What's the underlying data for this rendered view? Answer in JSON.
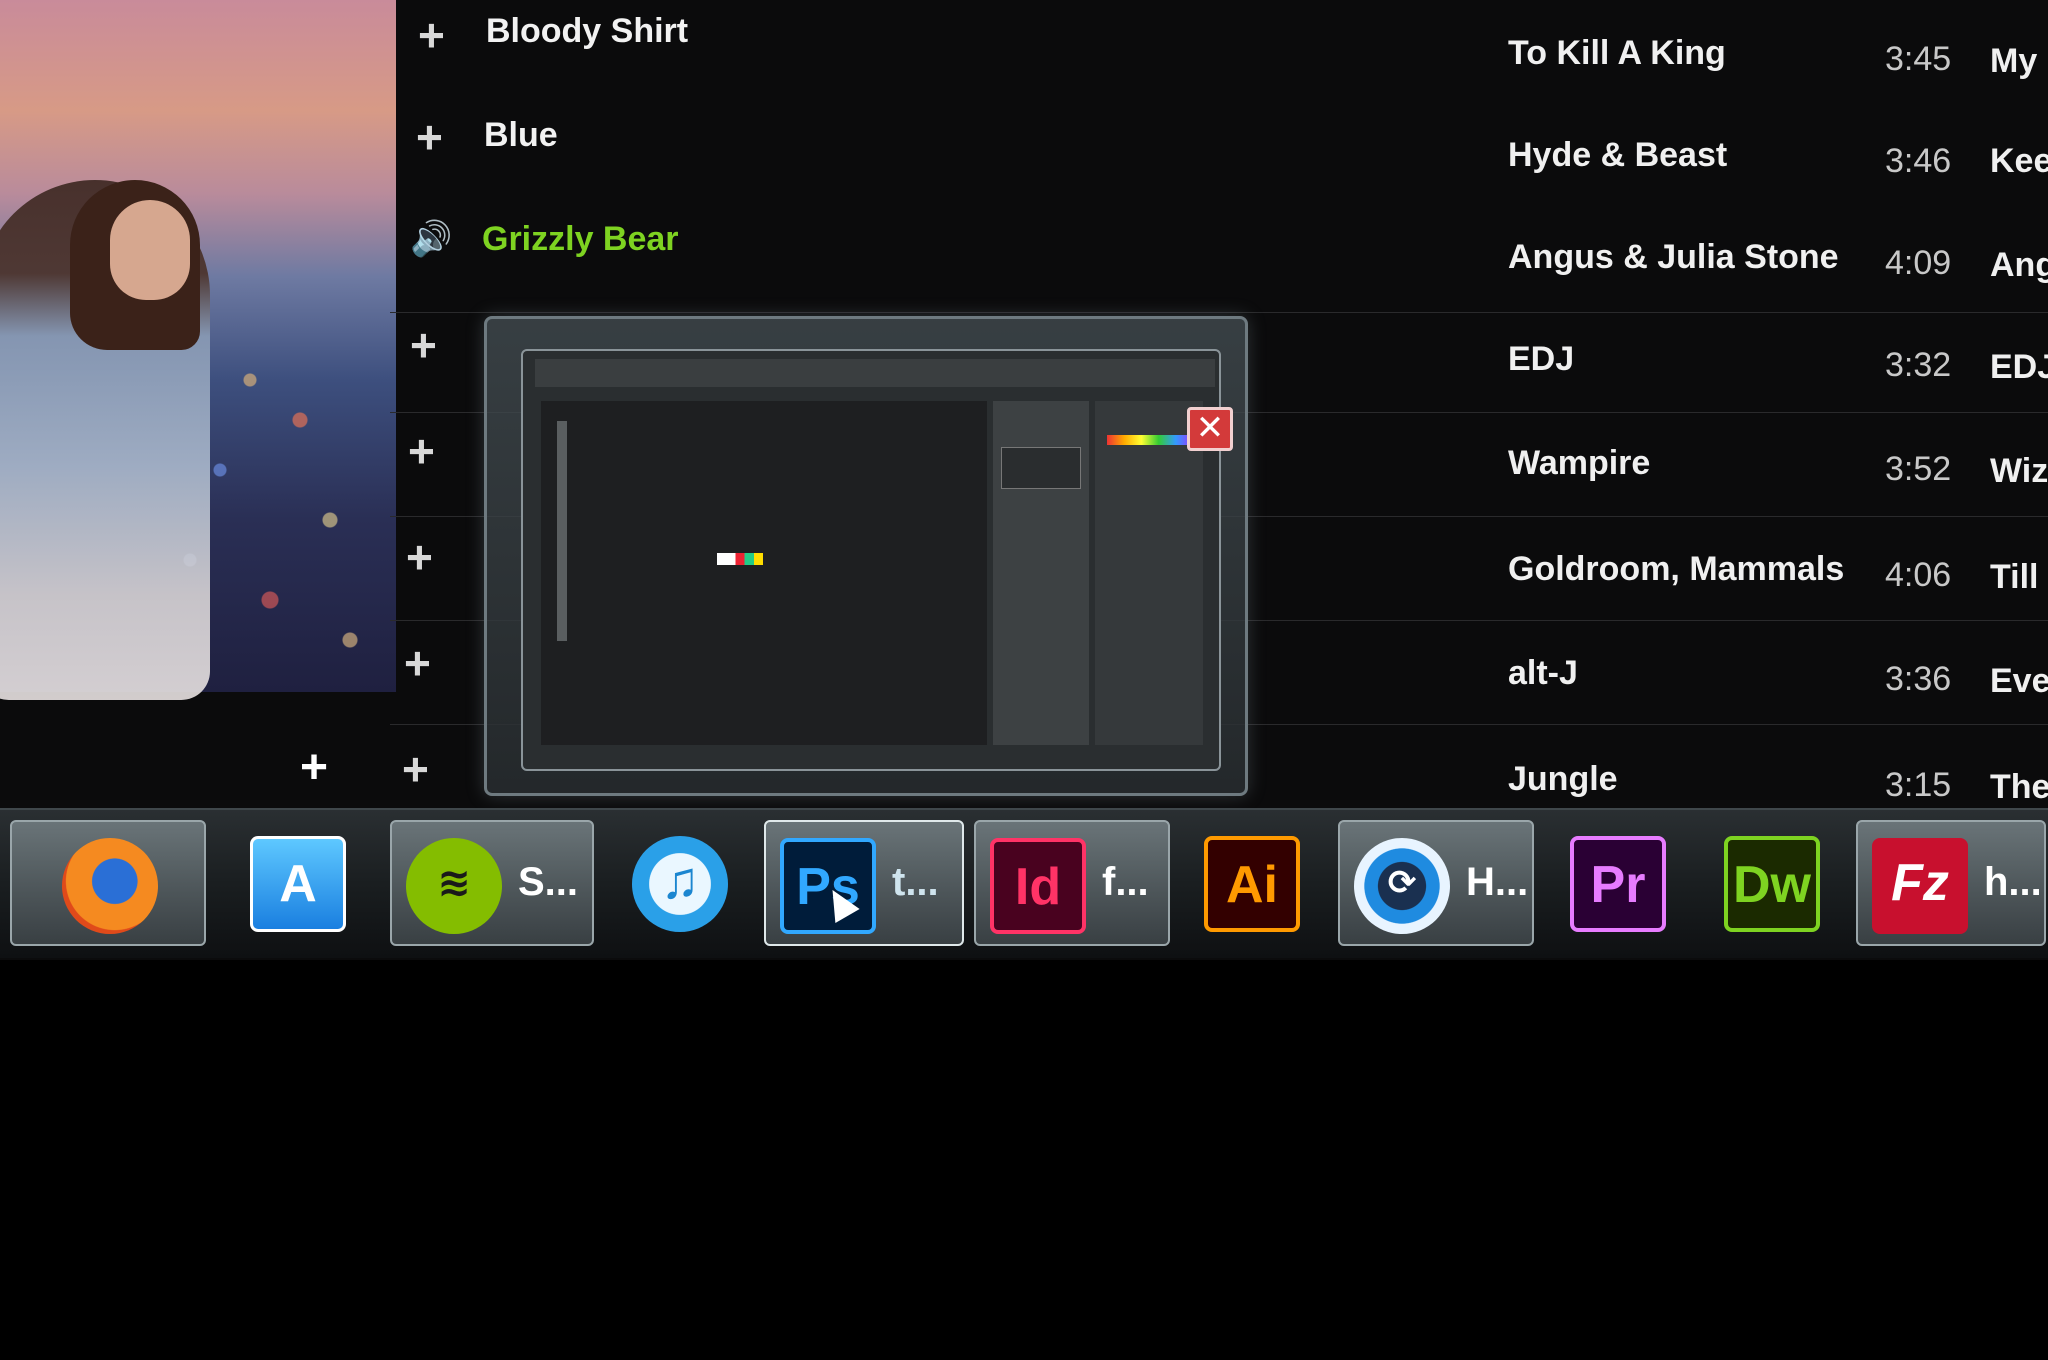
{
  "player": {
    "left_add_label": "+",
    "left_tracks": [
      {
        "title": "Bloody Shirt",
        "state": "add",
        "glyph": "+"
      },
      {
        "title": "Blue",
        "state": "add",
        "glyph": "+"
      },
      {
        "title": "Grizzly Bear",
        "state": "playing",
        "glyph": "🔊"
      },
      {
        "title": "",
        "state": "add",
        "glyph": "+"
      },
      {
        "title": "",
        "state": "add",
        "glyph": "+"
      },
      {
        "title": "",
        "state": "add",
        "glyph": "+"
      },
      {
        "title": "",
        "state": "add",
        "glyph": "+"
      },
      {
        "title": "",
        "state": "add",
        "glyph": "+"
      }
    ],
    "right_rows": [
      {
        "artist": "To Kill A King",
        "duration": "3:45",
        "album": "My"
      },
      {
        "artist": "Hyde & Beast",
        "duration": "3:46",
        "album": "Kee"
      },
      {
        "artist": "Angus & Julia Stone",
        "duration": "4:09",
        "album": "Ang",
        "playing": true
      },
      {
        "artist": "EDJ",
        "duration": "3:32",
        "album": "EDJ"
      },
      {
        "artist": "Wampire",
        "duration": "3:52",
        "album": "Wiz"
      },
      {
        "artist": "Goldroom, Mammals",
        "duration": "4:06",
        "album": "Till"
      },
      {
        "artist": "alt-J",
        "duration": "3:36",
        "album": "Eve"
      },
      {
        "artist": "Jungle",
        "duration": "3:15",
        "album": "The"
      }
    ],
    "accent_color": "#7ed321"
  },
  "preview": {
    "close_label": "✕"
  },
  "taskbar": {
    "items": [
      {
        "icon": "firefox-icon",
        "glyph": "",
        "label": "",
        "active": true
      },
      {
        "icon": "app-store-icon",
        "glyph": "A",
        "label": "",
        "active": false
      },
      {
        "icon": "spotify-icon",
        "glyph": "≋",
        "label": "S...",
        "active": true
      },
      {
        "icon": "itunes-icon",
        "glyph": "♫",
        "label": "",
        "active": false
      },
      {
        "icon": "photoshop-icon",
        "glyph": "Ps",
        "label": "t...",
        "active": true
      },
      {
        "icon": "indesign-icon",
        "glyph": "Id",
        "label": "f...",
        "active": true
      },
      {
        "icon": "illustrator-icon",
        "glyph": "Ai",
        "label": "",
        "active": false
      },
      {
        "icon": "timer-icon",
        "glyph": "⟳",
        "label": "H...",
        "active": true
      },
      {
        "icon": "premiere-icon",
        "glyph": "Pr",
        "label": "",
        "active": false
      },
      {
        "icon": "dreamweaver-icon",
        "glyph": "Dw",
        "label": "",
        "active": false
      },
      {
        "icon": "filezilla-icon",
        "glyph": "Fz",
        "label": "h...",
        "active": true
      }
    ]
  }
}
